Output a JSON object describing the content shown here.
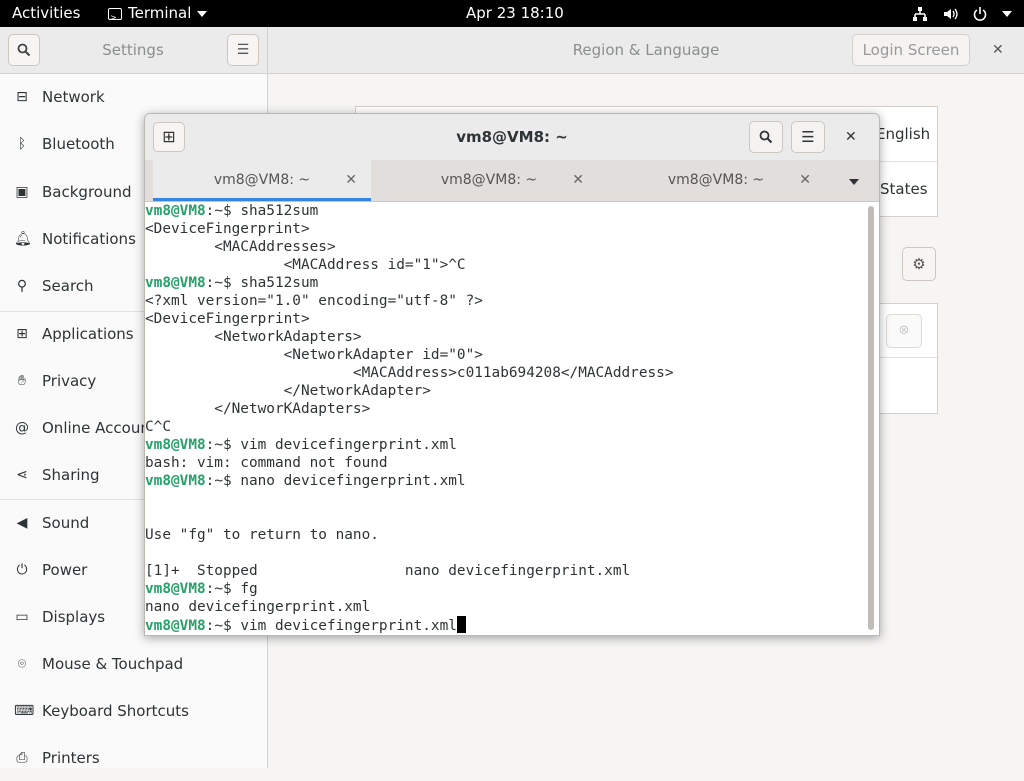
{
  "topbar": {
    "activities": "Activities",
    "app_name": "Terminal",
    "clock": "Apr 23  18:10"
  },
  "settings": {
    "sidebar_title": "Settings",
    "panel_title": "Region & Language",
    "login_screen": "Login Screen",
    "sidebar_items": [
      {
        "label": "Network",
        "icon": "network-icon"
      },
      {
        "label": "Bluetooth",
        "icon": "bluetooth-icon"
      },
      {
        "label": "Background",
        "icon": "background-icon"
      },
      {
        "label": "Notifications",
        "icon": "bell-icon"
      },
      {
        "label": "Search",
        "icon": "search-icon"
      },
      {
        "label": "Applications",
        "icon": "applications-icon"
      },
      {
        "label": "Privacy",
        "icon": "hand-icon"
      },
      {
        "label": "Online Accounts",
        "icon": "at-icon"
      },
      {
        "label": "Sharing",
        "icon": "share-icon"
      },
      {
        "label": "Sound",
        "icon": "speaker-icon"
      },
      {
        "label": "Power",
        "icon": "power-icon"
      },
      {
        "label": "Displays",
        "icon": "display-icon"
      },
      {
        "label": "Mouse & Touchpad",
        "icon": "mouse-icon"
      },
      {
        "label": "Keyboard Shortcuts",
        "icon": "keyboard-icon"
      },
      {
        "label": "Printers",
        "icon": "printer-icon"
      }
    ],
    "main": {
      "language_value": "English",
      "formats_value": "States"
    }
  },
  "terminal": {
    "title": "vm8@VM8: ~",
    "tabs": [
      "vm8@VM8: ~",
      "vm8@VM8: ~",
      "vm8@VM8: ~"
    ],
    "prompt_user": "vm8@VM8",
    "prompt_suffix": ":~$ ",
    "lines": [
      {
        "prompt": true,
        "text": "sha512sum"
      },
      {
        "prompt": false,
        "text": "<DeviceFingerprint>"
      },
      {
        "prompt": false,
        "text": "        <MACAddresses>"
      },
      {
        "prompt": false,
        "text": "                <MACAddress id=\"1\">^C"
      },
      {
        "prompt": true,
        "text": "sha512sum"
      },
      {
        "prompt": false,
        "text": "<?xml version=\"1.0\" encoding=\"utf-8\" ?>"
      },
      {
        "prompt": false,
        "text": "<DeviceFingerprint>"
      },
      {
        "prompt": false,
        "text": "        <NetworkAdapters>"
      },
      {
        "prompt": false,
        "text": "                <NetworkAdapter id=\"0\">"
      },
      {
        "prompt": false,
        "text": "                        <MACAddress>c011ab694208</MACAddress>"
      },
      {
        "prompt": false,
        "text": "                </NetworkAdapter>"
      },
      {
        "prompt": false,
        "text": "        </NetworKAdapters>"
      },
      {
        "prompt": false,
        "text": "C^C"
      },
      {
        "prompt": true,
        "text": "vim devicefingerprint.xml"
      },
      {
        "prompt": false,
        "text": "bash: vim: command not found"
      },
      {
        "prompt": true,
        "text": "nano devicefingerprint.xml"
      },
      {
        "prompt": false,
        "text": ""
      },
      {
        "prompt": false,
        "text": ""
      },
      {
        "prompt": false,
        "text": "Use \"fg\" to return to nano."
      },
      {
        "prompt": false,
        "text": ""
      },
      {
        "prompt": false,
        "text": "[1]+  Stopped                 nano devicefingerprint.xml"
      },
      {
        "prompt": true,
        "text": "fg"
      },
      {
        "prompt": false,
        "text": "nano devicefingerprint.xml"
      },
      {
        "prompt": true,
        "text": "vim devicefingerprint.xml",
        "cursor": true
      }
    ]
  }
}
